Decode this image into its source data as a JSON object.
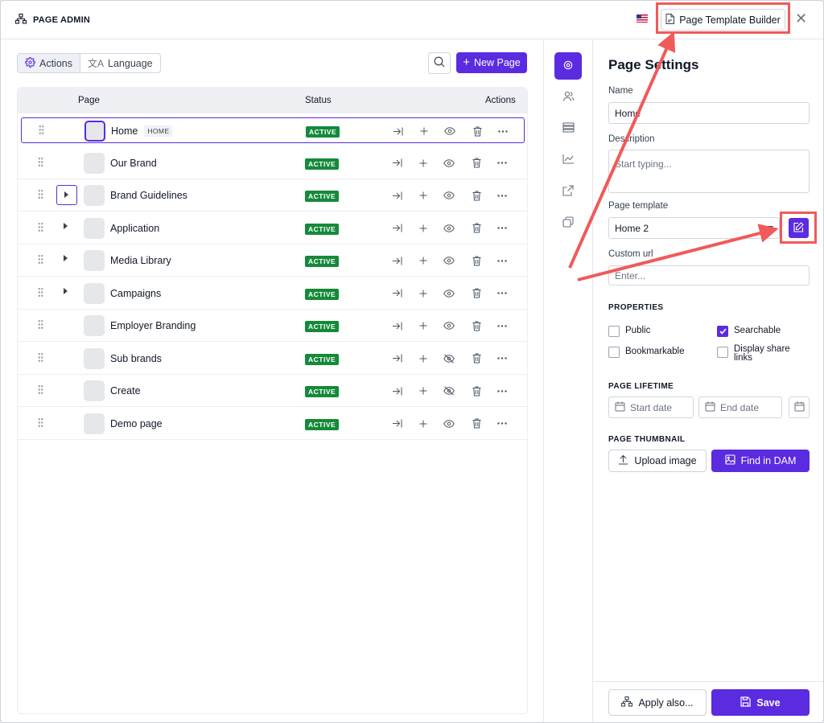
{
  "app": {
    "title": "PAGE ADMIN"
  },
  "header": {
    "template_builder_label": "Page Template Builder",
    "flag": "us-flag-icon"
  },
  "toolbar": {
    "actions_label": "Actions",
    "language_label": "Language",
    "new_page_label": "New Page"
  },
  "table": {
    "columns": {
      "page": "Page",
      "status": "Status",
      "actions": "Actions"
    },
    "rows": [
      {
        "name": "Home",
        "tag": "HOME",
        "status": "ACTIVE",
        "expandable": false,
        "visible": true,
        "selected": true
      },
      {
        "name": "Our Brand",
        "tag": "",
        "status": "ACTIVE",
        "expandable": false,
        "visible": true,
        "selected": false
      },
      {
        "name": "Brand Guidelines",
        "tag": "",
        "status": "ACTIVE",
        "expandable": true,
        "visible": true,
        "selected": false,
        "focused": true
      },
      {
        "name": "Application",
        "tag": "",
        "status": "ACTIVE",
        "expandable": true,
        "visible": true,
        "selected": false
      },
      {
        "name": "Media Library",
        "tag": "",
        "status": "ACTIVE",
        "expandable": true,
        "visible": true,
        "selected": false
      },
      {
        "name": "Campaigns",
        "tag": "",
        "status": "ACTIVE",
        "expandable": true,
        "visible": true,
        "selected": false
      },
      {
        "name": "Employer Branding",
        "tag": "",
        "status": "ACTIVE",
        "expandable": false,
        "visible": true,
        "selected": false
      },
      {
        "name": "Sub brands",
        "tag": "",
        "status": "ACTIVE",
        "expandable": false,
        "visible": false,
        "selected": false
      },
      {
        "name": "Create",
        "tag": "",
        "status": "ACTIVE",
        "expandable": false,
        "visible": false,
        "selected": false
      },
      {
        "name": "Demo page",
        "tag": "",
        "status": "ACTIVE",
        "expandable": false,
        "visible": true,
        "selected": false
      }
    ]
  },
  "settings": {
    "title": "Page Settings",
    "name_label": "Name",
    "name_value": "Home",
    "description_label": "Description",
    "description_placeholder": "Start typing...",
    "template_label": "Page template",
    "template_value": "Home 2",
    "custom_url_label": "Custom url",
    "custom_url_placeholder": "Enter...",
    "properties_title": "PROPERTIES",
    "properties": {
      "public": {
        "label": "Public",
        "checked": false
      },
      "searchable": {
        "label": "Searchable",
        "checked": true
      },
      "bookmarkable": {
        "label": "Bookmarkable",
        "checked": false
      },
      "share_links_line1": "Display share",
      "share_links_line2": "links",
      "share_links_checked": false
    },
    "lifetime_title": "PAGE LIFETIME",
    "start_date_placeholder": "Start date",
    "end_date_placeholder": "End date",
    "thumbnail_title": "PAGE THUMBNAIL",
    "upload_label": "Upload image",
    "find_dam_label": "Find in DAM",
    "apply_label": "Apply also...",
    "save_label": "Save"
  },
  "colors": {
    "accent": "#5b2be0",
    "status_green": "#158a3a",
    "annotation": "#f05a5a"
  }
}
